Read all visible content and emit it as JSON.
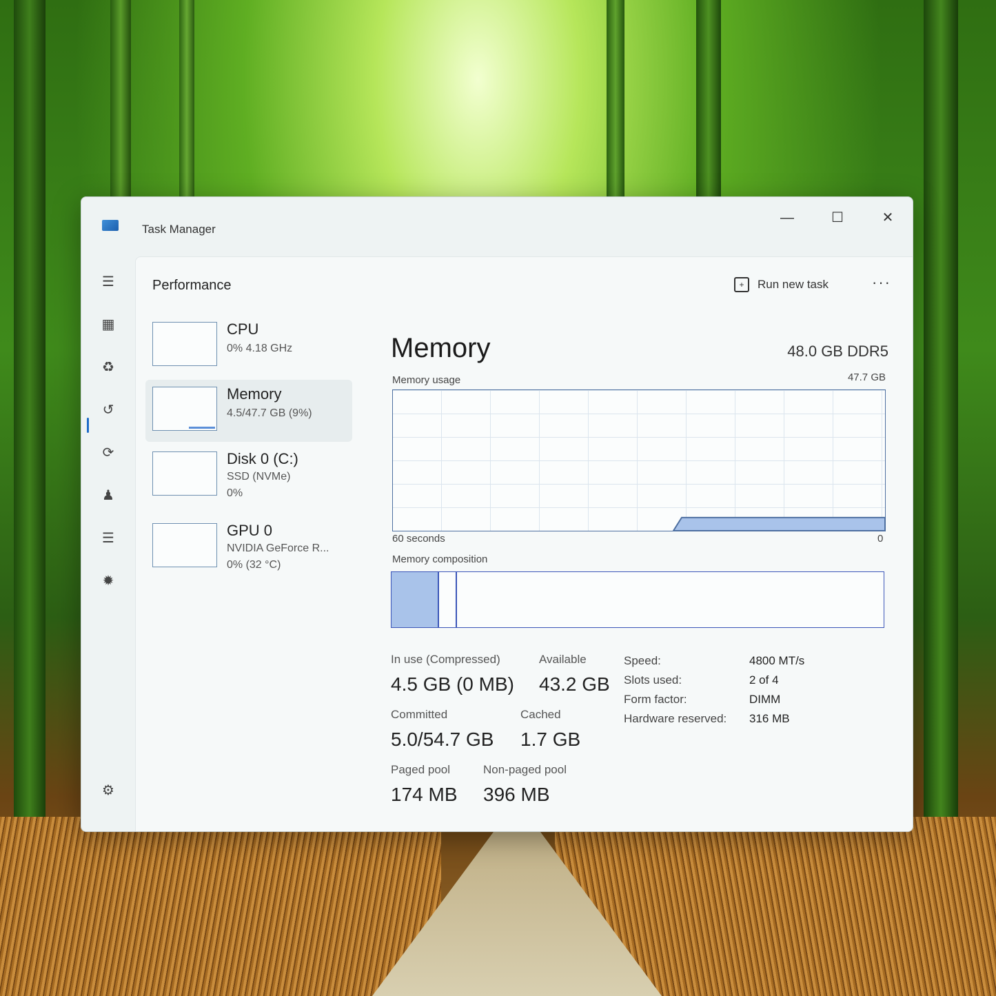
{
  "window": {
    "title": "Task Manager"
  },
  "header": {
    "title": "Performance",
    "run_new_task": "Run new task",
    "more": "···"
  },
  "devices": [
    {
      "name": "CPU",
      "sub1": "0%  4.18 GHz",
      "sub2": ""
    },
    {
      "name": "Memory",
      "sub1": "4.5/47.7 GB (9%)",
      "sub2": ""
    },
    {
      "name": "Disk 0 (C:)",
      "sub1": "SSD (NVMe)",
      "sub2": "0%"
    },
    {
      "name": "GPU 0",
      "sub1": "NVIDIA GeForce R...",
      "sub2": "0%  (32 °C)"
    }
  ],
  "memory": {
    "title": "Memory",
    "spec": "48.0 GB DDR5",
    "usage_label": "Memory usage",
    "usage_max": "47.7 GB",
    "time_label": "60 seconds",
    "time_zero": "0",
    "composition_label": "Memory composition",
    "usage_fraction": 0.094,
    "composition_inuse_fraction": 0.094,
    "composition_modified_fraction": 0.13
  },
  "stats": {
    "in_use_label": "In use (Compressed)",
    "in_use_value": "4.5 GB (0 MB)",
    "available_label": "Available",
    "available_value": "43.2 GB",
    "committed_label": "Committed",
    "committed_value": "5.0/54.7 GB",
    "cached_label": "Cached",
    "cached_value": "1.7 GB",
    "paged_label": "Paged pool",
    "paged_value": "174 MB",
    "nonpaged_label": "Non-paged pool",
    "nonpaged_value": "396 MB"
  },
  "specs": [
    {
      "label": "Speed:",
      "value": "4800 MT/s"
    },
    {
      "label": "Slots used:",
      "value": "2 of 4"
    },
    {
      "label": "Form factor:",
      "value": "DIMM"
    },
    {
      "label": "Hardware reserved:",
      "value": "316 MB"
    }
  ],
  "colors": {
    "accent": "#1f6cc9",
    "graph_line": "#4d6fa0",
    "graph_fill": "#a9c3ea"
  }
}
